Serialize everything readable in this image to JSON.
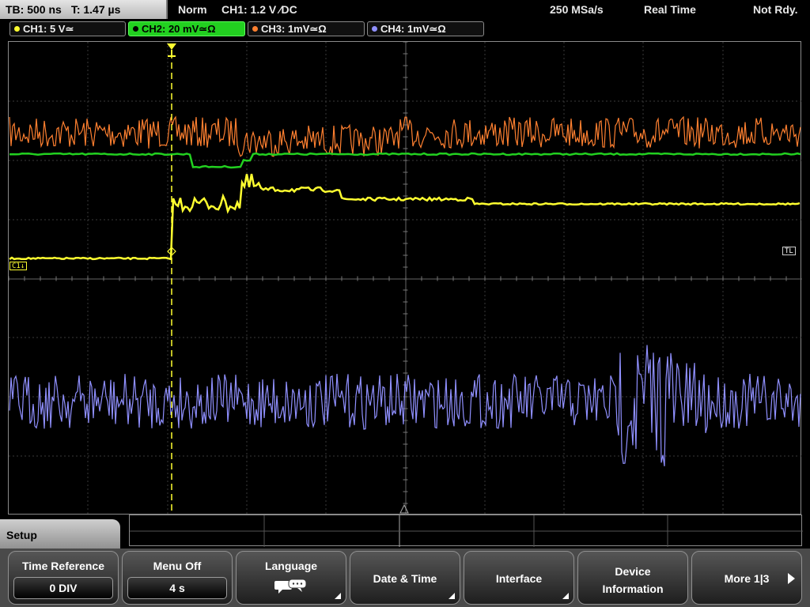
{
  "timebase": {
    "tb": "TB: 500 ns",
    "t": "T: 1.47 µs"
  },
  "status": {
    "trigger_mode": "Norm",
    "trigger_info": "CH1: 1.2 V ∕DC",
    "sample_rate": "250 MSa/s",
    "acq_mode": "Real Time",
    "state": "Not Rdy."
  },
  "channels": [
    {
      "label": "CH1: 5 V≃",
      "color": "#ffff30"
    },
    {
      "label": "CH2: 20 mV≃Ω",
      "color": "#22d020",
      "active": true
    },
    {
      "label": "CH3: 1mV≃Ω",
      "color": "#ff8030"
    },
    {
      "label": "CH4: 1mV≃Ω",
      "color": "#9090ff"
    }
  ],
  "markers": {
    "ch1": "C1↓",
    "trigger_level": "TL"
  },
  "colors": {
    "ch1": "#ffff30",
    "ch2": "#22d020",
    "ch3": "#ff8030",
    "ch4": "#9090ff",
    "grid": "#3a3a3a",
    "trigger": "#ffff30"
  },
  "menu": {
    "title": "Setup",
    "softkeys": [
      {
        "label": "Time Reference",
        "value": "0 DIV"
      },
      {
        "label": "Menu Off",
        "value": "4 s"
      },
      {
        "label": "Language",
        "icon": "speech-bubble-icon"
      },
      {
        "label": "Date & Time"
      },
      {
        "label": "Interface"
      },
      {
        "label": "Device Information"
      },
      {
        "label": "More 1|3",
        "icon": "right-arrow-icon"
      }
    ]
  }
}
